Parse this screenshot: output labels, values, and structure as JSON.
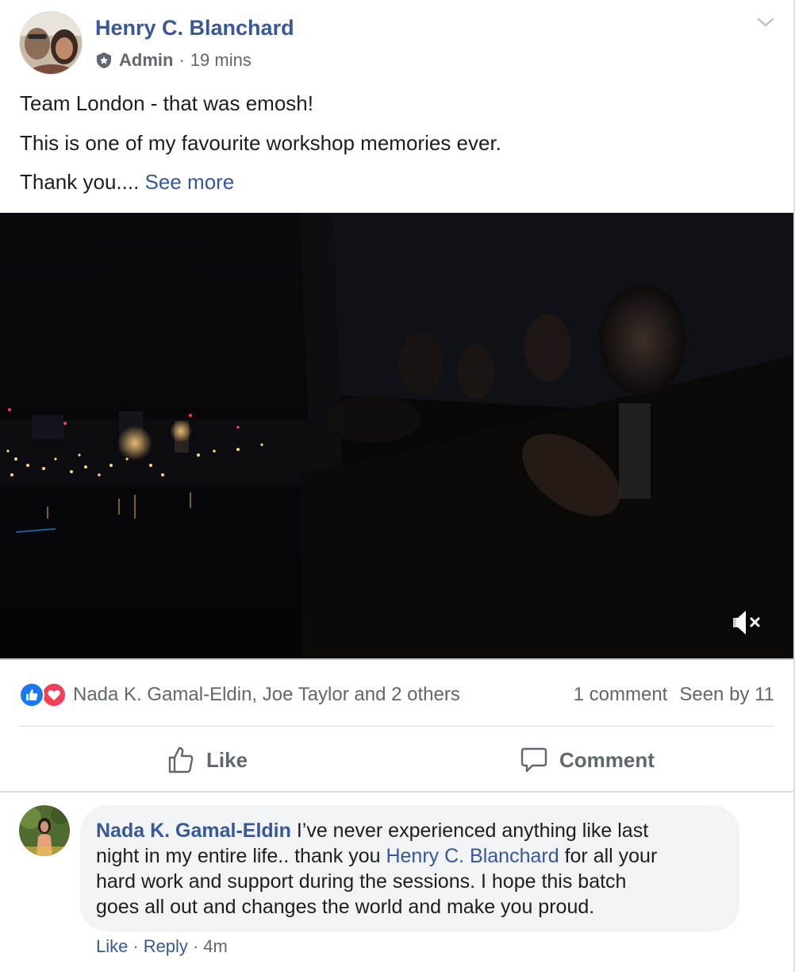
{
  "post": {
    "author": "Henry C. Blanchard",
    "role": "Admin",
    "meta_separator": "·",
    "time": "19 mins",
    "lines": [
      "Team London - that was emosh!",
      "This is one of my favourite workshop memories ever.",
      "Thank you...."
    ],
    "see_more": "See more"
  },
  "reactions": {
    "reactors": "Nada K. Gamal-Eldin, Joe Taylor and 2 others",
    "comments_count": "1 comment",
    "seen_by": "Seen by 11",
    "icons": [
      "like-icon",
      "love-icon"
    ]
  },
  "actions": {
    "like": "Like",
    "comment": "Comment"
  },
  "comment": {
    "author": "Nada K. Gamal-Eldin",
    "line1_text": " I’ve never experienced anything like last",
    "line2_pre": "night in my entire life.. thank you ",
    "mention": "Henry C. Blanchard",
    "line2_post": " for all your",
    "line3": "hard work and support during the sessions. I hope this batch",
    "line4": "goes all out and changes the world and make you proud.",
    "like": "Like",
    "reply": "Reply",
    "separator": "·",
    "time": "4m"
  },
  "colors": {
    "link": "#385898",
    "muted": "#606770",
    "like_blue": "#1877f2",
    "love_red": "#f33e58",
    "bubble": "#f2f3f5"
  }
}
